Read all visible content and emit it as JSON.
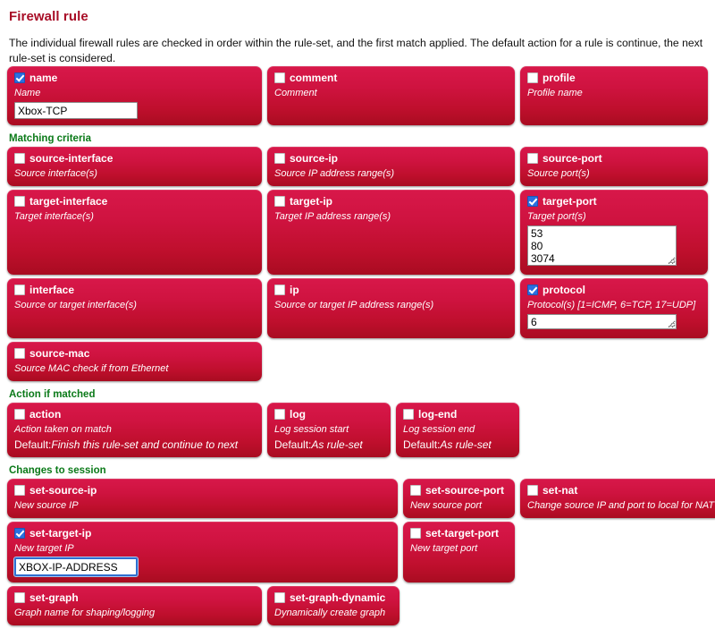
{
  "page": {
    "title": "Firewall rule",
    "intro": "The individual firewall rules are checked in order within the rule-set, and the first match applied. The default action for a rule is continue, the next rule-set is considered."
  },
  "colors": {
    "title": "#a80d26",
    "section_heading": "#0b7a19",
    "panel_top": "#d8184a",
    "panel_bottom": "#a90c21",
    "checkbox_checked": "#2a6fe0",
    "focus_ring": "#2f6fd0"
  },
  "sections": {
    "top": {
      "fields": [
        {
          "name": "name",
          "checked": true,
          "desc": "Name",
          "control": "input",
          "value": "Xbox-TCP"
        },
        {
          "name": "comment",
          "checked": false,
          "desc": "Comment"
        },
        {
          "name": "profile",
          "checked": false,
          "desc": "Profile name"
        }
      ]
    },
    "matching": {
      "heading": "Matching criteria",
      "fields": [
        {
          "name": "source-interface",
          "checked": false,
          "desc": "Source interface(s)"
        },
        {
          "name": "source-ip",
          "checked": false,
          "desc": "Source IP address range(s)"
        },
        {
          "name": "source-port",
          "checked": false,
          "desc": "Source port(s)"
        },
        {
          "name": "target-interface",
          "checked": false,
          "desc": "Target interface(s)"
        },
        {
          "name": "target-ip",
          "checked": false,
          "desc": "Target IP address range(s)"
        },
        {
          "name": "target-port",
          "checked": true,
          "desc": "Target port(s)",
          "control": "textarea",
          "value": "53\n80\n3074"
        },
        {
          "name": "interface",
          "checked": false,
          "desc": "Source or target interface(s)"
        },
        {
          "name": "ip",
          "checked": false,
          "desc": "Source or target IP address range(s)"
        },
        {
          "name": "protocol",
          "checked": true,
          "desc": "Protocol(s) [1=ICMP, 6=TCP, 17=UDP]",
          "control": "textarea",
          "value": "6"
        },
        {
          "name": "source-mac",
          "checked": false,
          "desc": "Source MAC check if from Ethernet"
        }
      ]
    },
    "action": {
      "heading": "Action if matched",
      "fields": [
        {
          "name": "action",
          "checked": false,
          "desc": "Action taken on match",
          "default_label": "Default:",
          "default_value": "Finish this rule-set and continue to next"
        },
        {
          "name": "log",
          "checked": false,
          "desc": "Log session start",
          "default_label": "Default:",
          "default_value": "As rule-set"
        },
        {
          "name": "log-end",
          "checked": false,
          "desc": "Log session end",
          "default_label": "Default:",
          "default_value": "As rule-set"
        }
      ]
    },
    "changes": {
      "heading": "Changes to session",
      "fields": [
        {
          "name": "set-source-ip",
          "checked": false,
          "desc": "New source IP"
        },
        {
          "name": "set-source-port",
          "checked": false,
          "desc": "New source port"
        },
        {
          "name": "set-nat",
          "checked": false,
          "desc": "Change source IP and port to local for NAT"
        },
        {
          "name": "set-target-ip",
          "checked": true,
          "desc": "New target IP",
          "control": "input",
          "value": "XBOX-IP-ADDRESS",
          "focused": true
        },
        {
          "name": "set-target-port",
          "checked": false,
          "desc": "New target port"
        },
        {
          "name": "set-graph",
          "checked": false,
          "desc": "Graph name for shaping/logging"
        },
        {
          "name": "set-graph-dynamic",
          "checked": false,
          "desc": "Dynamically create graph"
        }
      ]
    }
  }
}
